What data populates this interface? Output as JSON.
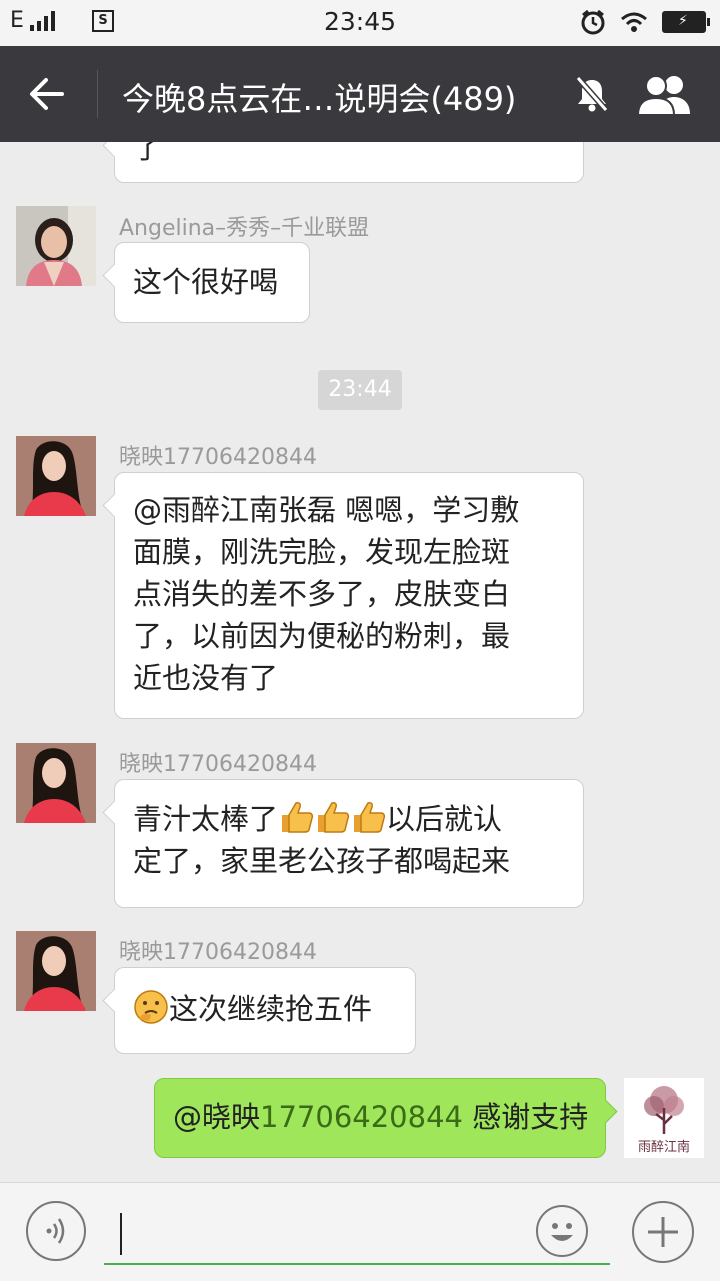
{
  "status_bar": {
    "carrier": "E",
    "time": "23:45"
  },
  "header": {
    "title": "今晚8点云在…说明会(489)"
  },
  "messages": [
    {
      "id": "m0",
      "type": "incoming",
      "text": "了"
    },
    {
      "id": "m1",
      "type": "incoming",
      "sender": "Angelina–秀秀–千业联盟",
      "text": "这个很好喝"
    },
    {
      "id": "m2",
      "type": "incoming",
      "sender": "晓映17706420844",
      "lines": [
        "@雨醉江南张磊 嗯嗯，学习敷",
        "面膜，刚洗完脸，发现左脸斑",
        "点消失的差不多了，皮肤变白",
        "了，以前因为便秘的粉刺，最",
        "近也没有了"
      ]
    },
    {
      "id": "m3",
      "type": "incoming",
      "sender": "晓映17706420844",
      "line1_prefix": "青汁太棒了",
      "line1_suffix": "以后就认",
      "line2": "定了，家里老公孩子都喝起来",
      "emoji": "thumbs-up-icon"
    },
    {
      "id": "m4",
      "type": "incoming",
      "sender": "晓映17706420844",
      "text": "这次继续抢五件",
      "emoji": "thinking-face-icon"
    },
    {
      "id": "m5",
      "type": "outgoing",
      "mention": "@晓映",
      "mention_num": "17706420844",
      "text": " 感谢支持",
      "avatar_text": "雨醉江南"
    }
  ],
  "time_divider": "23:44",
  "icons": {
    "back": "back-arrow-icon",
    "mute": "mute-bell-icon",
    "members": "group-members-icon",
    "voice": "voice-icon",
    "emoji": "smiley-icon",
    "more": "plus-icon"
  },
  "colors": {
    "header_bg": "#3a3a3e",
    "chat_bg": "#ececec",
    "outgoing_bubble": "#9fe65a",
    "input_underline": "#45b349"
  }
}
